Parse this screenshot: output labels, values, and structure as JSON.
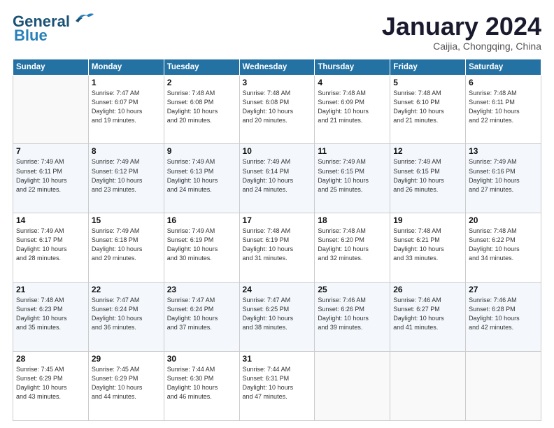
{
  "header": {
    "logo_line1": "General",
    "logo_line2": "Blue",
    "month": "January 2024",
    "location": "Caijia, Chongqing, China"
  },
  "days_of_week": [
    "Sunday",
    "Monday",
    "Tuesday",
    "Wednesday",
    "Thursday",
    "Friday",
    "Saturday"
  ],
  "weeks": [
    [
      {
        "day": "",
        "info": ""
      },
      {
        "day": "1",
        "info": "Sunrise: 7:47 AM\nSunset: 6:07 PM\nDaylight: 10 hours\nand 19 minutes."
      },
      {
        "day": "2",
        "info": "Sunrise: 7:48 AM\nSunset: 6:08 PM\nDaylight: 10 hours\nand 20 minutes."
      },
      {
        "day": "3",
        "info": "Sunrise: 7:48 AM\nSunset: 6:08 PM\nDaylight: 10 hours\nand 20 minutes."
      },
      {
        "day": "4",
        "info": "Sunrise: 7:48 AM\nSunset: 6:09 PM\nDaylight: 10 hours\nand 21 minutes."
      },
      {
        "day": "5",
        "info": "Sunrise: 7:48 AM\nSunset: 6:10 PM\nDaylight: 10 hours\nand 21 minutes."
      },
      {
        "day": "6",
        "info": "Sunrise: 7:48 AM\nSunset: 6:11 PM\nDaylight: 10 hours\nand 22 minutes."
      }
    ],
    [
      {
        "day": "7",
        "info": "Sunrise: 7:49 AM\nSunset: 6:11 PM\nDaylight: 10 hours\nand 22 minutes."
      },
      {
        "day": "8",
        "info": "Sunrise: 7:49 AM\nSunset: 6:12 PM\nDaylight: 10 hours\nand 23 minutes."
      },
      {
        "day": "9",
        "info": "Sunrise: 7:49 AM\nSunset: 6:13 PM\nDaylight: 10 hours\nand 24 minutes."
      },
      {
        "day": "10",
        "info": "Sunrise: 7:49 AM\nSunset: 6:14 PM\nDaylight: 10 hours\nand 24 minutes."
      },
      {
        "day": "11",
        "info": "Sunrise: 7:49 AM\nSunset: 6:15 PM\nDaylight: 10 hours\nand 25 minutes."
      },
      {
        "day": "12",
        "info": "Sunrise: 7:49 AM\nSunset: 6:15 PM\nDaylight: 10 hours\nand 26 minutes."
      },
      {
        "day": "13",
        "info": "Sunrise: 7:49 AM\nSunset: 6:16 PM\nDaylight: 10 hours\nand 27 minutes."
      }
    ],
    [
      {
        "day": "14",
        "info": "Sunrise: 7:49 AM\nSunset: 6:17 PM\nDaylight: 10 hours\nand 28 minutes."
      },
      {
        "day": "15",
        "info": "Sunrise: 7:49 AM\nSunset: 6:18 PM\nDaylight: 10 hours\nand 29 minutes."
      },
      {
        "day": "16",
        "info": "Sunrise: 7:49 AM\nSunset: 6:19 PM\nDaylight: 10 hours\nand 30 minutes."
      },
      {
        "day": "17",
        "info": "Sunrise: 7:48 AM\nSunset: 6:19 PM\nDaylight: 10 hours\nand 31 minutes."
      },
      {
        "day": "18",
        "info": "Sunrise: 7:48 AM\nSunset: 6:20 PM\nDaylight: 10 hours\nand 32 minutes."
      },
      {
        "day": "19",
        "info": "Sunrise: 7:48 AM\nSunset: 6:21 PM\nDaylight: 10 hours\nand 33 minutes."
      },
      {
        "day": "20",
        "info": "Sunrise: 7:48 AM\nSunset: 6:22 PM\nDaylight: 10 hours\nand 34 minutes."
      }
    ],
    [
      {
        "day": "21",
        "info": "Sunrise: 7:48 AM\nSunset: 6:23 PM\nDaylight: 10 hours\nand 35 minutes."
      },
      {
        "day": "22",
        "info": "Sunrise: 7:47 AM\nSunset: 6:24 PM\nDaylight: 10 hours\nand 36 minutes."
      },
      {
        "day": "23",
        "info": "Sunrise: 7:47 AM\nSunset: 6:24 PM\nDaylight: 10 hours\nand 37 minutes."
      },
      {
        "day": "24",
        "info": "Sunrise: 7:47 AM\nSunset: 6:25 PM\nDaylight: 10 hours\nand 38 minutes."
      },
      {
        "day": "25",
        "info": "Sunrise: 7:46 AM\nSunset: 6:26 PM\nDaylight: 10 hours\nand 39 minutes."
      },
      {
        "day": "26",
        "info": "Sunrise: 7:46 AM\nSunset: 6:27 PM\nDaylight: 10 hours\nand 41 minutes."
      },
      {
        "day": "27",
        "info": "Sunrise: 7:46 AM\nSunset: 6:28 PM\nDaylight: 10 hours\nand 42 minutes."
      }
    ],
    [
      {
        "day": "28",
        "info": "Sunrise: 7:45 AM\nSunset: 6:29 PM\nDaylight: 10 hours\nand 43 minutes."
      },
      {
        "day": "29",
        "info": "Sunrise: 7:45 AM\nSunset: 6:29 PM\nDaylight: 10 hours\nand 44 minutes."
      },
      {
        "day": "30",
        "info": "Sunrise: 7:44 AM\nSunset: 6:30 PM\nDaylight: 10 hours\nand 46 minutes."
      },
      {
        "day": "31",
        "info": "Sunrise: 7:44 AM\nSunset: 6:31 PM\nDaylight: 10 hours\nand 47 minutes."
      },
      {
        "day": "",
        "info": ""
      },
      {
        "day": "",
        "info": ""
      },
      {
        "day": "",
        "info": ""
      }
    ]
  ]
}
